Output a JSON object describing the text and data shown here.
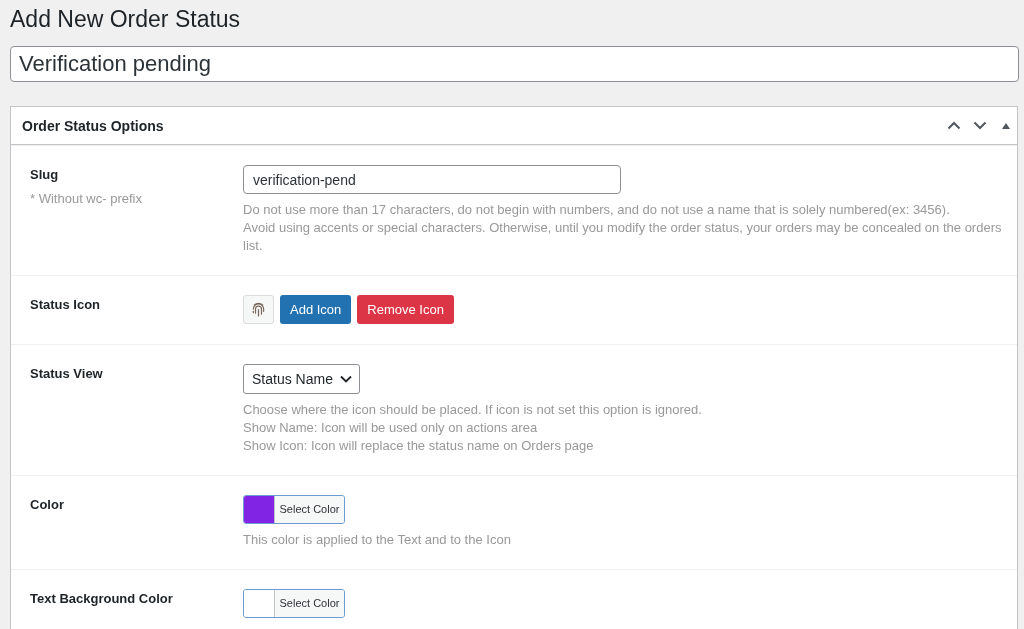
{
  "page": {
    "title": "Add New Order Status"
  },
  "title_field": {
    "value": "Verification pending"
  },
  "panel": {
    "title": "Order Status Options",
    "rows": [
      {
        "kind": "text",
        "label": "Slug",
        "hint": "* Without wc- prefix",
        "value": "verification-pend",
        "description": [
          "Do not use more than 17 characters, do not begin with numbers, and do not use a name that is solely numbered(ex: 3456).",
          "Avoid using accents or special characters. Otherwise, until you modify the order status, your orders may be concealed on the orders list."
        ]
      },
      {
        "kind": "icon",
        "label": "Status Icon",
        "buttons": [
          {
            "kind": "primary",
            "label": "Add Icon"
          },
          {
            "kind": "danger",
            "label": "Remove Icon"
          }
        ]
      },
      {
        "kind": "select",
        "label": "Status View",
        "value": "Status Name",
        "description": [
          "Choose where the icon should be placed. If icon is not set this option is ignored.",
          "Show Name: Icon will be used only on actions area",
          "Show Icon: Icon will replace the status name on Orders page"
        ]
      },
      {
        "kind": "color",
        "label": "Color",
        "color": "#8224e3",
        "button": "Select Color",
        "description": [
          "This color is applied to the Text and to the Icon"
        ]
      },
      {
        "kind": "color",
        "label": "Text Background Color",
        "color": "#ffffff",
        "button": "Select Color"
      }
    ]
  }
}
